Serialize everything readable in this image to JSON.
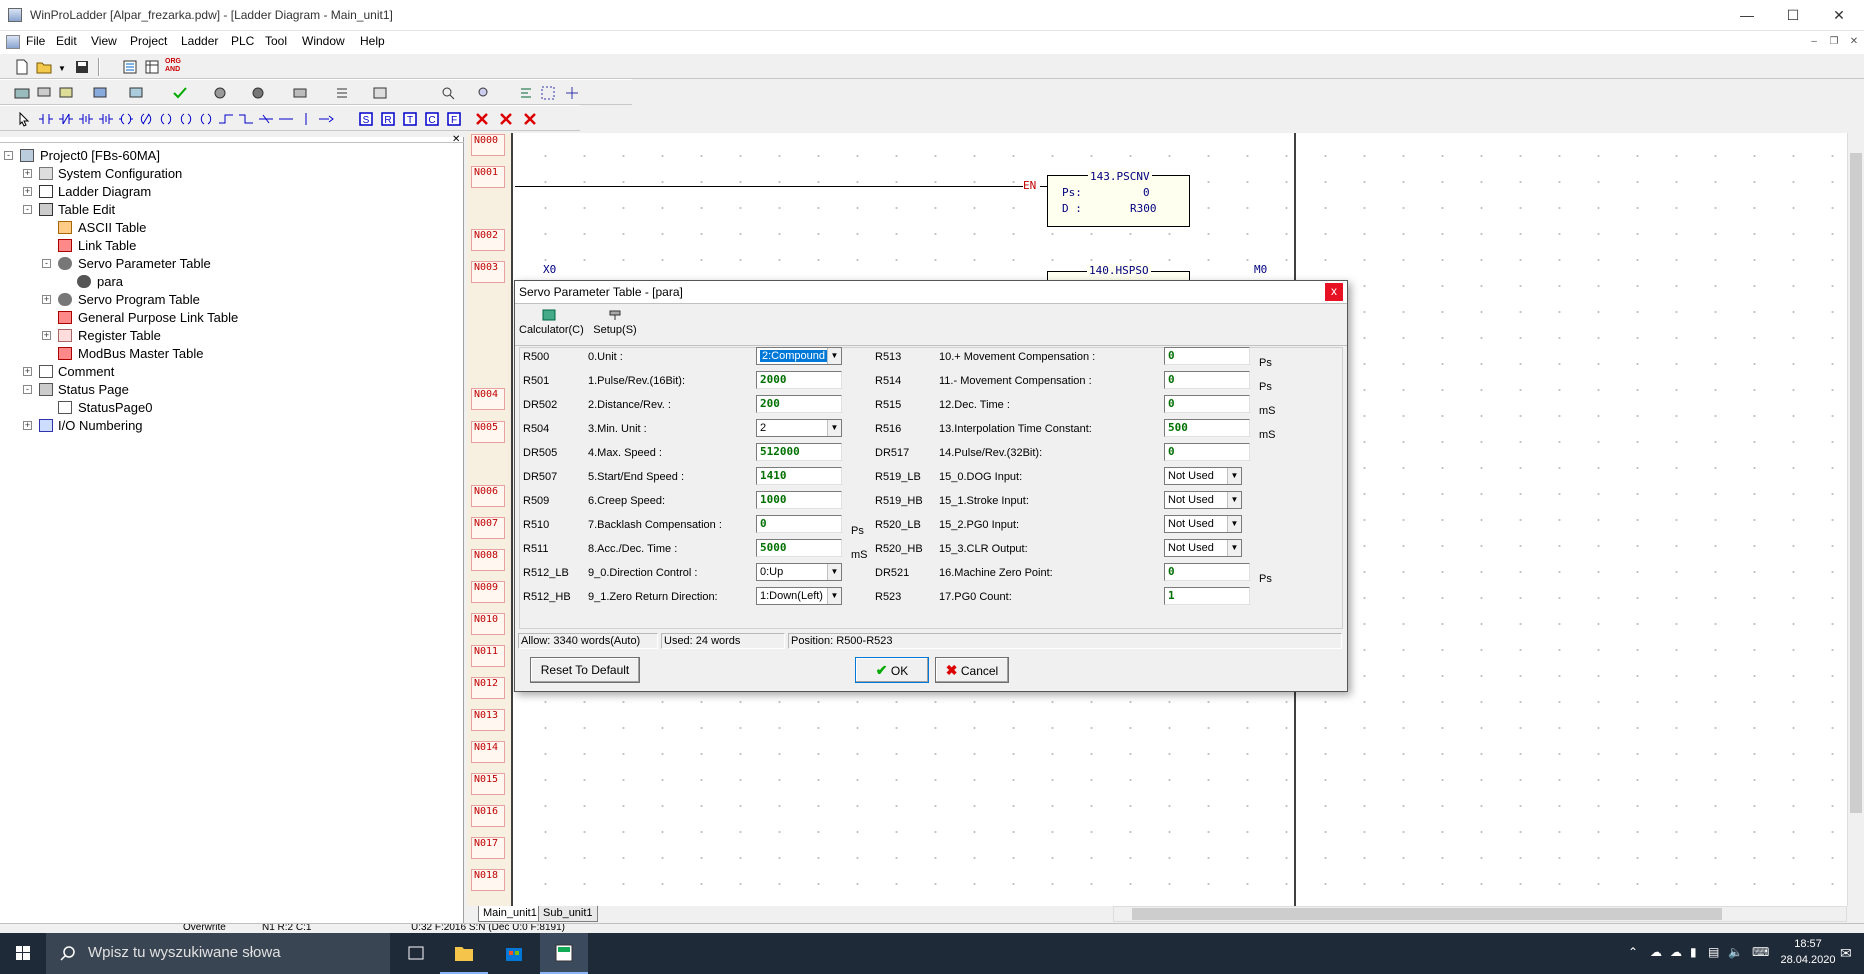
{
  "window": {
    "title": "WinProLadder [Alpar_frezarka.pdw] - [Ladder Diagram - Main_unit1]"
  },
  "menu": [
    "File",
    "Edit",
    "View",
    "Project",
    "Ladder",
    "PLC",
    "Tool",
    "Window",
    "Help"
  ],
  "tree": {
    "root": "Project0 [FBs-60MA]",
    "items": [
      "System Configuration",
      "Ladder Diagram",
      "Table Edit",
      "ASCII Table",
      "Link Table",
      "Servo Parameter Table",
      "para",
      "Servo Program Table",
      "General Purpose Link Table",
      "Register Table",
      "ModBus Master Table",
      "Comment",
      "Status Page",
      "StatusPage0",
      "I/O Numbering"
    ]
  },
  "ladder": {
    "rungs": [
      "N000",
      "N001",
      "N002",
      "N003",
      "N004",
      "N005",
      "N006",
      "N007",
      "N008",
      "N009",
      "N010",
      "N011",
      "N012",
      "N013",
      "N014",
      "N015",
      "N016",
      "N017",
      "N018"
    ],
    "en_label": "EN",
    "block1": {
      "title": "143.PSCNV",
      "ps_label": "Ps:",
      "ps_value": "0",
      "d_label": "D :",
      "d_value": "R300"
    },
    "block2": {
      "title": "140.HSPSO"
    },
    "contact_x0": "X0",
    "coil_m0": "M0"
  },
  "dialog": {
    "title": "Servo Parameter Table - [para]",
    "close": "x",
    "toolbar": {
      "calculator": "Calculator(C)",
      "setup": "Setup(S)"
    },
    "left_params": [
      {
        "reg": "R500",
        "name": "0.Unit :",
        "value": "2:Compound",
        "kind": "select-selected",
        "unit": ""
      },
      {
        "reg": "R501",
        "name": "1.Pulse/Rev.(16Bit):",
        "value": "2000",
        "kind": "field",
        "unit": ""
      },
      {
        "reg": "DR502",
        "name": "2.Distance/Rev. :",
        "value": "200",
        "kind": "field",
        "unit": ""
      },
      {
        "reg": "R504",
        "name": "3.Min. Unit :",
        "value": "2",
        "kind": "select",
        "unit": ""
      },
      {
        "reg": "DR505",
        "name": "4.Max. Speed :",
        "value": "512000",
        "kind": "field",
        "unit": ""
      },
      {
        "reg": "DR507",
        "name": "5.Start/End Speed :",
        "value": "1410",
        "kind": "field",
        "unit": ""
      },
      {
        "reg": "R509",
        "name": "6.Creep Speed:",
        "value": "1000",
        "kind": "field",
        "unit": ""
      },
      {
        "reg": "R510",
        "name": "7.Backlash Compensation :",
        "value": "0",
        "kind": "field",
        "unit": "Ps"
      },
      {
        "reg": "R511",
        "name": "8.Acc./Dec. Time :",
        "value": "5000",
        "kind": "field",
        "unit": "mS"
      },
      {
        "reg": "R512_LB",
        "name": "9_0.Direction Control :",
        "value": "0:Up",
        "kind": "select",
        "unit": ""
      },
      {
        "reg": "R512_HB",
        "name": "9_1.Zero Return Direction:",
        "value": "1:Down(Left)",
        "kind": "select",
        "unit": ""
      }
    ],
    "right_params": [
      {
        "reg": "R513",
        "name": "10.+ Movement Compensation :",
        "value": "0",
        "kind": "field",
        "unit": "Ps"
      },
      {
        "reg": "R514",
        "name": "11.- Movement Compensation :",
        "value": "0",
        "kind": "field",
        "unit": "Ps"
      },
      {
        "reg": "R515",
        "name": "12.Dec. Time :",
        "value": "0",
        "kind": "field",
        "unit": "mS"
      },
      {
        "reg": "R516",
        "name": "13.Interpolation Time Constant:",
        "value": "500",
        "kind": "field",
        "unit": "mS"
      },
      {
        "reg": "DR517",
        "name": "14.Pulse/Rev.(32Bit):",
        "value": "0",
        "kind": "field",
        "unit": ""
      },
      {
        "reg": "R519_LB",
        "name": "15_0.DOG Input:",
        "value": "Not Used",
        "kind": "select",
        "unit": ""
      },
      {
        "reg": "R519_HB",
        "name": "15_1.Stroke Input:",
        "value": "Not Used",
        "kind": "select",
        "unit": ""
      },
      {
        "reg": "R520_LB",
        "name": "15_2.PG0 Input:",
        "value": "Not Used",
        "kind": "select",
        "unit": ""
      },
      {
        "reg": "R520_HB",
        "name": "15_3.CLR Output:",
        "value": "Not Used",
        "kind": "select",
        "unit": ""
      },
      {
        "reg": "DR521",
        "name": "16.Machine Zero Point:",
        "value": "0",
        "kind": "field",
        "unit": "Ps"
      },
      {
        "reg": "R523",
        "name": "17.PG0 Count:",
        "value": "1",
        "kind": "field",
        "unit": ""
      }
    ],
    "status": {
      "allow": "Allow: 3340 words(Auto)",
      "used": "Used: 24 words",
      "position": "Position: R500-R523"
    },
    "buttons": {
      "reset": "Reset To Default",
      "ok": "OK",
      "cancel": "Cancel"
    }
  },
  "tabs": [
    "Main_unit1",
    "Sub_unit1"
  ],
  "statusbar": {
    "mode": "Overwrite",
    "pos": "N1 R:2 C:1",
    "info": "U:32 F:2016 S:N (Dec U:0 F:8191)"
  },
  "taskbar": {
    "search_placeholder": "Wpisz tu wyszukiwane słowa",
    "time": "18:57",
    "date": "28.04.2020"
  },
  "colors": {
    "accent": "#0078d7",
    "value_green": "#007000",
    "rung_red": "#c00000",
    "taskbar": "#1f2a38"
  }
}
